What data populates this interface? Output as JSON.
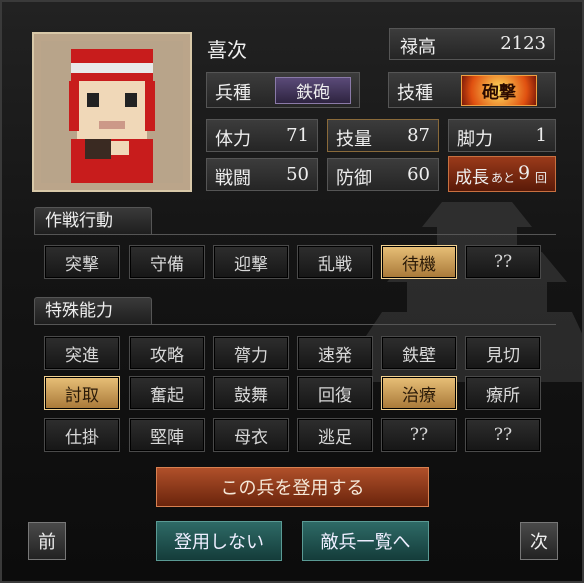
{
  "unit": {
    "name": "喜次"
  },
  "stipend": {
    "label": "禄高",
    "value": "2123"
  },
  "troop": {
    "label": "兵種",
    "value": "鉄砲"
  },
  "tech": {
    "label": "技種",
    "value": "砲撃"
  },
  "stats": [
    {
      "label": "体力",
      "value": "71"
    },
    {
      "label": "技量",
      "value": "87"
    },
    {
      "label": "脚力",
      "value": "1"
    },
    {
      "label": "戦闘",
      "value": "50"
    },
    {
      "label": "防御",
      "value": "60"
    }
  ],
  "growth": {
    "label": "成長",
    "suffix_small": "あと",
    "value": "9",
    "unit": "回"
  },
  "tactics": {
    "title": "作戦行動",
    "items": [
      {
        "label": "突撃",
        "active": false
      },
      {
        "label": "守備",
        "active": false
      },
      {
        "label": "迎撃",
        "active": false
      },
      {
        "label": "乱戦",
        "active": false
      },
      {
        "label": "待機",
        "active": true
      },
      {
        "label": "??",
        "active": false
      }
    ]
  },
  "abilities": {
    "title": "特殊能力",
    "items": [
      {
        "label": "突進",
        "active": false
      },
      {
        "label": "攻略",
        "active": false
      },
      {
        "label": "膂力",
        "active": false
      },
      {
        "label": "速発",
        "active": false
      },
      {
        "label": "鉄壁",
        "active": false
      },
      {
        "label": "見切",
        "active": false
      },
      {
        "label": "討取",
        "active": true
      },
      {
        "label": "奮起",
        "active": false
      },
      {
        "label": "鼓舞",
        "active": false
      },
      {
        "label": "回復",
        "active": false
      },
      {
        "label": "治療",
        "active": true
      },
      {
        "label": "療所",
        "active": false
      },
      {
        "label": "仕掛",
        "active": false
      },
      {
        "label": "堅陣",
        "active": false
      },
      {
        "label": "母衣",
        "active": false
      },
      {
        "label": "逃足",
        "active": false
      },
      {
        "label": "??",
        "active": false
      },
      {
        "label": "??",
        "active": false
      }
    ]
  },
  "actions": {
    "hire": "この兵を登用する",
    "decline": "登用しない",
    "enemy_list": "敵兵一覧へ",
    "prev": "前",
    "next": "次"
  },
  "colors": {
    "active_fill": "#d8a858",
    "hire_button": "#8a3a18",
    "teal_button": "#1e4a48"
  }
}
